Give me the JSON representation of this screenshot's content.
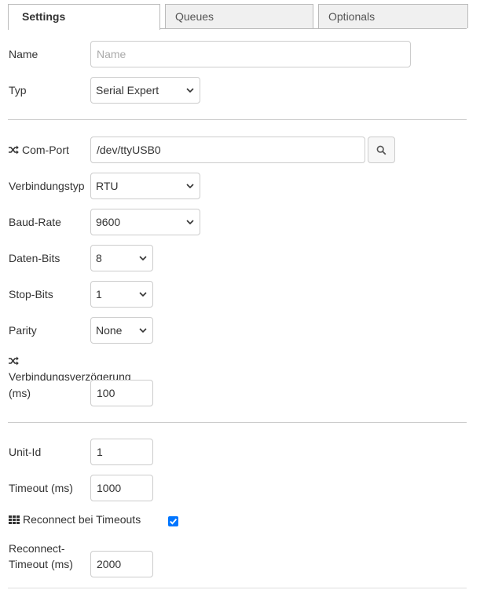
{
  "tabs": [
    {
      "label": "Settings"
    },
    {
      "label": "Queues"
    },
    {
      "label": "Optionals"
    }
  ],
  "name": {
    "label": "Name",
    "placeholder": "Name",
    "value": ""
  },
  "typ": {
    "label": "Typ",
    "value": "Serial Expert"
  },
  "com_port": {
    "label": "Com-Port",
    "value": "/dev/ttyUSB0",
    "icon": "shuffle-icon",
    "button_icon": "search-icon"
  },
  "verbindungstyp": {
    "label": "Verbindungstyp",
    "value": "RTU"
  },
  "baud_rate": {
    "label": "Baud-Rate",
    "value": "9600"
  },
  "daten_bits": {
    "label": "Daten-Bits",
    "value": "8"
  },
  "stop_bits": {
    "label": "Stop-Bits",
    "value": "1"
  },
  "parity": {
    "label": "Parity",
    "value": "None"
  },
  "verzoegerung": {
    "label_line1": "Verbindungsverzögerung",
    "label_line2": "(ms)",
    "value": "100",
    "icon": "shuffle-icon"
  },
  "unit_id": {
    "label": "Unit-Id",
    "value": "1"
  },
  "timeout": {
    "label": "Timeout (ms)",
    "value": "1000"
  },
  "reconnect": {
    "label": "Reconnect bei Timeouts",
    "checked": true,
    "icon": "grid-icon"
  },
  "reconnect_timeout": {
    "label_line1": "Reconnect-",
    "label_line2": "Timeout (ms)",
    "value": "2000"
  },
  "colors": {
    "accent": "#0075ff",
    "border": "#cccccc",
    "tab_bg": "#f0f0f0"
  }
}
